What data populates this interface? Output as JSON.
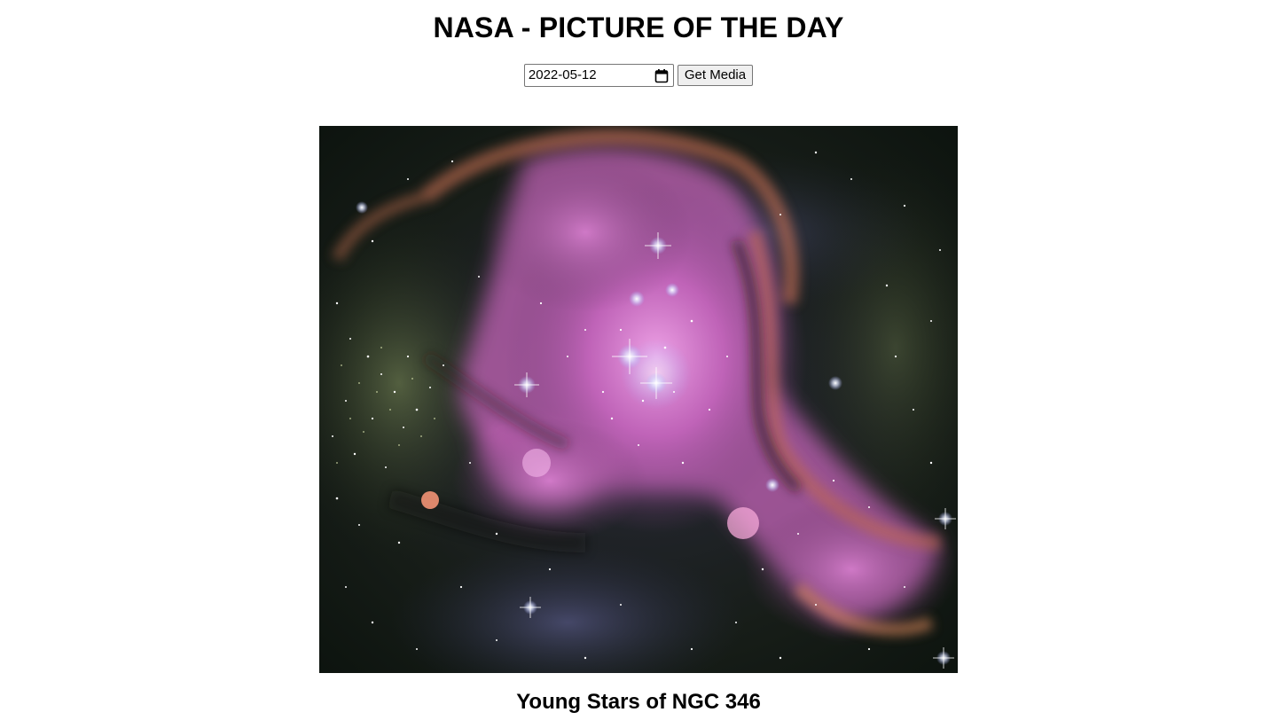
{
  "header": {
    "title": "NASA - PICTURE OF THE DAY"
  },
  "controls": {
    "date_value": "2022-05-12",
    "button_label": "Get Media"
  },
  "media": {
    "title": "Young Stars of NGC 346",
    "type": "image"
  },
  "icons": {
    "date_picker": "calendar-icon"
  }
}
